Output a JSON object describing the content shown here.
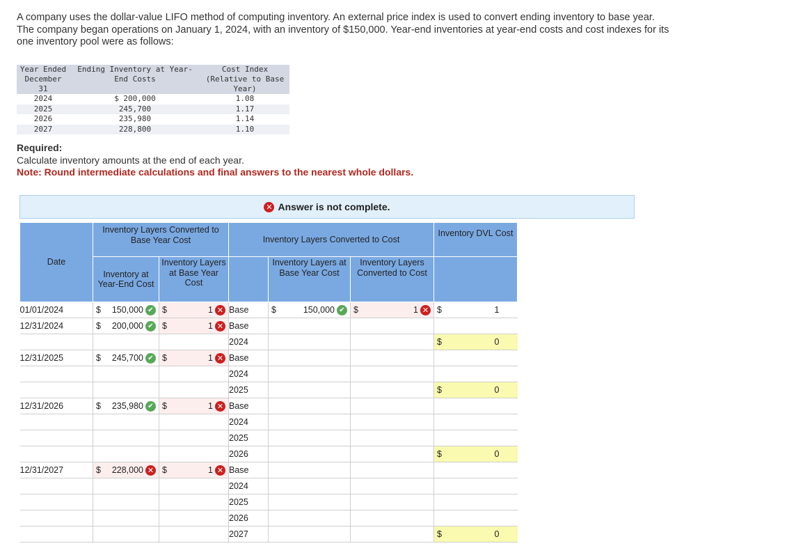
{
  "intro": "A company uses the dollar-value LIFO method of computing inventory. An external price index is used to convert ending inventory to base year. The company began operations on January 1, 2024, with an inventory of $150,000. Year-end inventories at year-end costs and cost indexes for its one inventory pool were as follows:",
  "given_table": {
    "headers": [
      "Year Ended December 31",
      "Ending Inventory at Year-End Costs",
      "Cost Index (Relative to Base Year)"
    ],
    "rows": [
      [
        "2024",
        "$ 200,000",
        "1.08"
      ],
      [
        "2025",
        "245,700",
        "1.17"
      ],
      [
        "2026",
        "235,980",
        "1.14"
      ],
      [
        "2027",
        "228,800",
        "1.10"
      ]
    ]
  },
  "required_title": "Required:",
  "required_text": "Calculate inventory amounts at the end of each year.",
  "note": "Note: Round intermediate calculations and final answers to the nearest whole dollars.",
  "banner": "Answer is not complete.",
  "headers": {
    "date": "Date",
    "group1": "Inventory Layers Converted to Base Year Cost",
    "group2": "Inventory Layers Converted to Cost",
    "dvl": "Inventory DVL Cost",
    "col_end_cost": "Inventory at Year-End Cost",
    "col_base_layers": "Inventory Layers at Base Year Cost",
    "col_layers_base": "Inventory Layers at Base Year Cost",
    "col_layers_converted": "Inventory Layers Converted to Cost"
  },
  "rows": [
    {
      "date": "01/01/2024",
      "end_cost": "150,000",
      "end_status": "correct",
      "base_layer": "1",
      "base_status": "incorrect",
      "label": "Base",
      "layer_base": "150,000",
      "layer_base_status": "correct",
      "converted": "1",
      "converted_status": "incorrect",
      "dvl": "1",
      "dvl_dollar": true,
      "dvl_yellow": false
    },
    {
      "date": "12/31/2024",
      "end_cost": "200,000",
      "end_status": "correct",
      "base_layer": "1",
      "base_status": "incorrect",
      "label": "Base"
    },
    {
      "label": "2024",
      "dvl": "0",
      "dvl_dollar": true,
      "dvl_yellow": true
    },
    {
      "date": "12/31/2025",
      "end_cost": "245,700",
      "end_status": "correct",
      "base_layer": "1",
      "base_status": "incorrect",
      "label": "Base"
    },
    {
      "label": "2024"
    },
    {
      "label": "2025",
      "dvl": "0",
      "dvl_dollar": true,
      "dvl_yellow": true
    },
    {
      "date": "12/31/2026",
      "end_cost": "235,980",
      "end_status": "correct",
      "base_layer": "1",
      "base_status": "incorrect",
      "label": "Base"
    },
    {
      "label": "2024"
    },
    {
      "label": "2025"
    },
    {
      "label": "2026",
      "dvl": "0",
      "dvl_dollar": true,
      "dvl_yellow": true
    },
    {
      "date": "12/31/2027",
      "end_cost": "228,000",
      "end_status": "incorrect",
      "base_layer": "1",
      "base_status": "incorrect",
      "label": "Base"
    },
    {
      "label": "2024"
    },
    {
      "label": "2025"
    },
    {
      "label": "2026"
    },
    {
      "label": "2027",
      "dvl": "0",
      "dvl_dollar": true,
      "dvl_yellow": true
    }
  ],
  "dollar_sign": "$",
  "icons": {
    "correct": "check-icon",
    "incorrect": "x-icon"
  },
  "colors": {
    "header_blue": "#7aa9e2",
    "banner_bg": "#e2f0fb",
    "note_red": "#b0281f",
    "correct_green": "#59a85a",
    "incorrect_red": "#cc1f1f",
    "highlight_yellow": "#fafab0"
  }
}
